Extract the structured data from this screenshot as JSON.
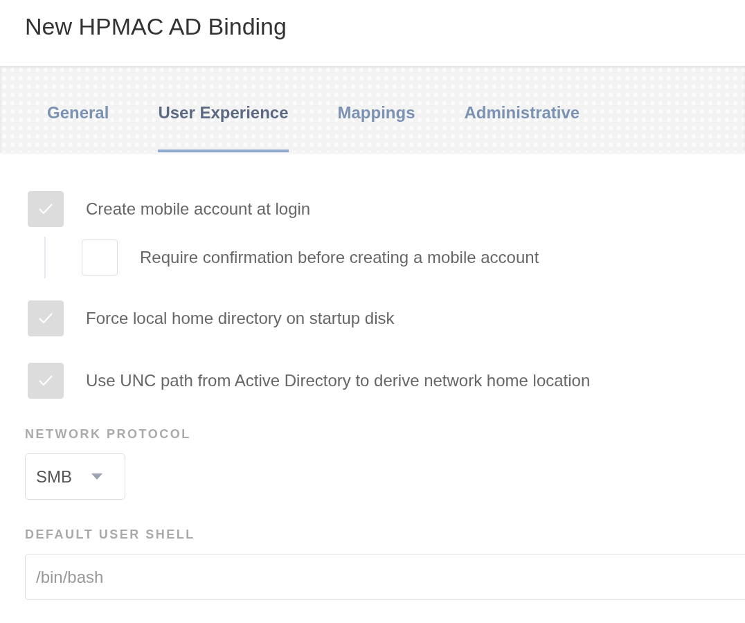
{
  "window": {
    "title": "New HPMAC AD Binding"
  },
  "tabs": [
    {
      "label": "General",
      "selected": false
    },
    {
      "label": "User Experience",
      "selected": true
    },
    {
      "label": "Mappings",
      "selected": false
    },
    {
      "label": "Administrative",
      "selected": false
    }
  ],
  "options": [
    {
      "label": "Create mobile account at login",
      "checked": true,
      "children": [
        {
          "label": "Require confirmation before creating a mobile account",
          "checked": false
        }
      ]
    },
    {
      "label": "Force local home directory on startup disk",
      "checked": true
    },
    {
      "label": "Use UNC path from Active Directory to derive network home location",
      "checked": true
    }
  ],
  "network_protocol": {
    "label": "NETWORK PROTOCOL",
    "value": "SMB"
  },
  "default_user_shell": {
    "label": "DEFAULT USER SHELL",
    "placeholder": "/bin/bash"
  }
}
